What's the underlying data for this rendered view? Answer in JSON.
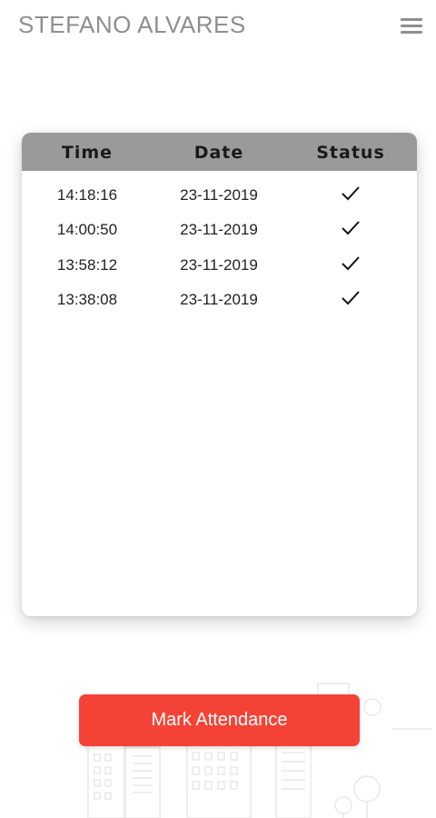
{
  "header": {
    "title": "STEFANO ALVARES",
    "menu_icon": "hamburger-menu-icon"
  },
  "attendance_table": {
    "columns": [
      "Time",
      "Date",
      "Status"
    ],
    "rows": [
      {
        "time": "14:18:16",
        "date": "23-11-2019",
        "status": "check-icon"
      },
      {
        "time": "14:00:50",
        "date": "23-11-2019",
        "status": "check-icon"
      },
      {
        "time": "13:58:12",
        "date": "23-11-2019",
        "status": "check-icon"
      },
      {
        "time": "13:38:08",
        "date": "23-11-2019",
        "status": "check-icon"
      }
    ]
  },
  "actions": {
    "mark_attendance_label": "Mark Attendance"
  },
  "colors": {
    "accent": "#f44336",
    "header_bg": "#9a9a9a",
    "title_text": "#8f8f8f"
  }
}
